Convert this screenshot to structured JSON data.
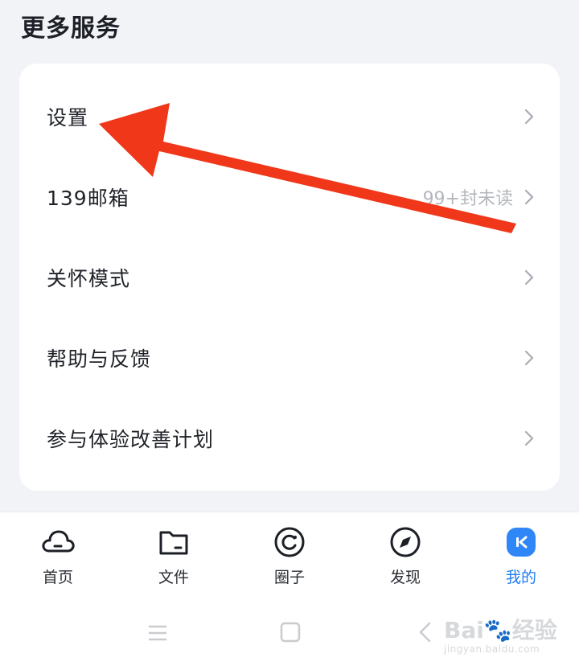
{
  "section": {
    "title": "更多服务"
  },
  "menu": {
    "items": [
      {
        "label": "设置",
        "extra": ""
      },
      {
        "label": "139邮箱",
        "extra": "99+封未读"
      },
      {
        "label": "关怀模式",
        "extra": ""
      },
      {
        "label": "帮助与反馈",
        "extra": ""
      },
      {
        "label": "参与体验改善计划",
        "extra": ""
      }
    ]
  },
  "annotation": {
    "color": "#f0371a"
  },
  "tabbar": {
    "active_color": "#1e7cf2",
    "tabs": [
      {
        "label": "首页",
        "icon": "cloud-icon"
      },
      {
        "label": "文件",
        "icon": "folder-icon"
      },
      {
        "label": "圈子",
        "icon": "circle-refresh-icon"
      },
      {
        "label": "发现",
        "icon": "compass-icon"
      },
      {
        "label": "我的",
        "icon": "profile-icon",
        "active": true
      }
    ]
  },
  "watermark": {
    "brand": "Bai",
    "brand_cn": "经验",
    "domain": "jingyan.baidu.com"
  }
}
